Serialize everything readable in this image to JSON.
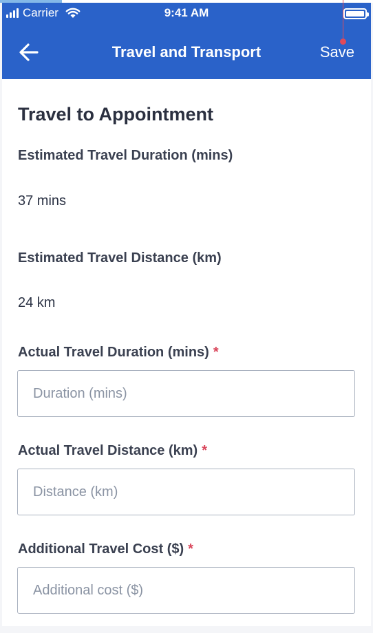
{
  "status_bar": {
    "carrier": "Carrier",
    "time": "9:41 AM"
  },
  "nav": {
    "title": "Travel and Transport",
    "save_label": "Save"
  },
  "section": {
    "title": "Travel to Appointment"
  },
  "estimated": {
    "duration_label": "Estimated Travel Duration (mins)",
    "duration_value": "37 mins",
    "distance_label": "Estimated Travel Distance (km)",
    "distance_value": "24 km"
  },
  "actual": {
    "duration_label": "Actual Travel Duration (mins)",
    "duration_placeholder": "Duration (mins)",
    "distance_label": "Actual Travel Distance (km)",
    "distance_placeholder": "Distance (km)",
    "cost_label": "Additional Travel Cost ($)",
    "cost_placeholder": "Additional cost ($)",
    "required_mark": "*"
  },
  "colors": {
    "header_bg": "#2a62c9",
    "required": "#d9455a",
    "field_border": "#a9b1bf"
  },
  "icons": {
    "back": "arrow-left-icon",
    "wifi": "wifi-icon",
    "battery": "battery-icon",
    "signal": "signal-icon"
  }
}
